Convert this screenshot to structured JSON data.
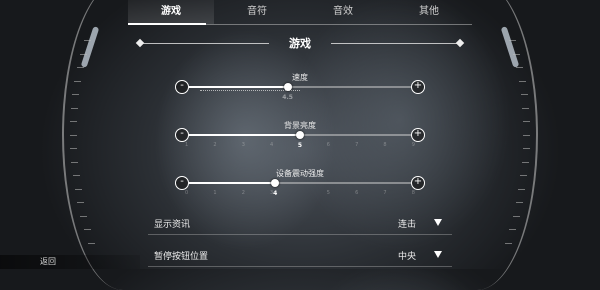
{
  "tabs": [
    {
      "label": "游戏",
      "active": true
    },
    {
      "label": "音符",
      "active": false
    },
    {
      "label": "音效",
      "active": false
    },
    {
      "label": "其他",
      "active": false
    }
  ],
  "section": {
    "title": "游戏"
  },
  "sliders": [
    {
      "label": "速度",
      "value_text": "4.5",
      "value": 4.5,
      "min": 1,
      "max": 9,
      "ticks": [
        "1",
        "2",
        "3",
        "4",
        "5",
        "6",
        "7",
        "8",
        "9"
      ]
    },
    {
      "label": "背景亮度",
      "value_text": "5",
      "value": 5,
      "min": 1,
      "max": 9,
      "ticks": [
        "1",
        "2",
        "3",
        "4",
        "5",
        "6",
        "7",
        "8",
        "9"
      ]
    },
    {
      "label": "设备震动强度",
      "value_text": "4",
      "value": 4,
      "min": 1,
      "max": 9,
      "ticks": [
        "0",
        "1",
        "2",
        "3",
        "4",
        "5",
        "6",
        "7",
        "8"
      ]
    }
  ],
  "controls": {
    "minus": "-",
    "plus": "+"
  },
  "settings": [
    {
      "label": "显示资讯",
      "value": "连击"
    },
    {
      "label": "暂停按钮位置",
      "value": "中央"
    }
  ],
  "back": {
    "label": "返回"
  },
  "icons": {
    "minus": "minus-icon",
    "plus": "plus-icon",
    "dropdown": "caret-down-icon",
    "diamond": "diamond-icon"
  }
}
